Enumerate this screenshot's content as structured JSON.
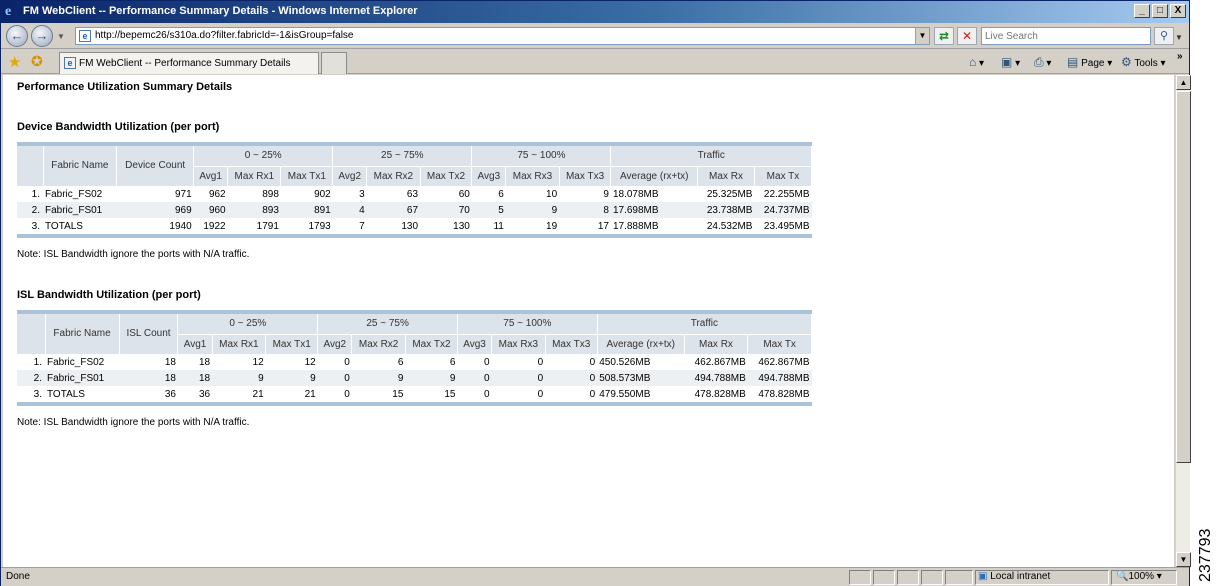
{
  "window": {
    "title": "FM WebClient -- Performance Summary Details - Windows Internet Explorer",
    "minimize": "_",
    "maximize": "□",
    "close": "X"
  },
  "address": {
    "url": "http://bepemc26/s310a.do?filter.fabricId=-1&isGroup=false",
    "search_placeholder": "Live Search"
  },
  "tab": {
    "label": "FM WebClient -- Performance Summary Details"
  },
  "commands": {
    "page": "Page",
    "tools": "Tools"
  },
  "page": {
    "title": "Performance Utilization Summary Details",
    "device_section": "Device Bandwidth Utilization (per port)",
    "isl_section": "ISL Bandwidth Utilization (per port)",
    "note": "Note: ISL Bandwidth ignore the ports with N/A traffic."
  },
  "device_table": {
    "groups": [
      "0 ~ 25%",
      "25 ~ 75%",
      "75 ~ 100%",
      "Traffic"
    ],
    "name_header": "Fabric Name",
    "count_header": "Device Count",
    "subheaders": [
      "Avg1",
      "Max Rx1",
      "Max Tx1",
      "Avg2",
      "Max Rx2",
      "Max Tx2",
      "Avg3",
      "Max Rx3",
      "Max Tx3",
      "Average (rx+tx)",
      "Max Rx",
      "Max Tx"
    ],
    "rows": [
      [
        "1.",
        "Fabric_FS02",
        "971",
        "962",
        "898",
        "902",
        "3",
        "63",
        "60",
        "6",
        "10",
        "9",
        "18.078MB",
        "25.325MB",
        "22.255MB"
      ],
      [
        "2.",
        "Fabric_FS01",
        "969",
        "960",
        "893",
        "891",
        "4",
        "67",
        "70",
        "5",
        "9",
        "8",
        "17.698MB",
        "23.738MB",
        "24.737MB"
      ],
      [
        "3.",
        "TOTALS",
        "1940",
        "1922",
        "1791",
        "1793",
        "7",
        "130",
        "130",
        "11",
        "19",
        "17",
        "17.888MB",
        "24.532MB",
        "23.495MB"
      ]
    ]
  },
  "isl_table": {
    "groups": [
      "0 ~ 25%",
      "25 ~ 75%",
      "75 ~ 100%",
      "Traffic"
    ],
    "name_header": "Fabric Name",
    "count_header": "ISL Count",
    "subheaders": [
      "Avg1",
      "Max Rx1",
      "Max Tx1",
      "Avg2",
      "Max Rx2",
      "Max Tx2",
      "Avg3",
      "Max Rx3",
      "Max Tx3",
      "Average (rx+tx)",
      "Max Rx",
      "Max Tx"
    ],
    "rows": [
      [
        "1.",
        "Fabric_FS02",
        "18",
        "18",
        "12",
        "12",
        "0",
        "6",
        "6",
        "0",
        "0",
        "0",
        "450.526MB",
        "462.867MB",
        "462.867MB"
      ],
      [
        "2.",
        "Fabric_FS01",
        "18",
        "18",
        "9",
        "9",
        "0",
        "9",
        "9",
        "0",
        "0",
        "0",
        "508.573MB",
        "494.788MB",
        "494.788MB"
      ],
      [
        "3.",
        "TOTALS",
        "36",
        "36",
        "21",
        "21",
        "0",
        "15",
        "15",
        "0",
        "0",
        "0",
        "479.550MB",
        "478.828MB",
        "478.828MB"
      ]
    ]
  },
  "status": {
    "text": "Done",
    "zone": "Local intranet",
    "zoom": "100%"
  },
  "figure_id": "237793"
}
